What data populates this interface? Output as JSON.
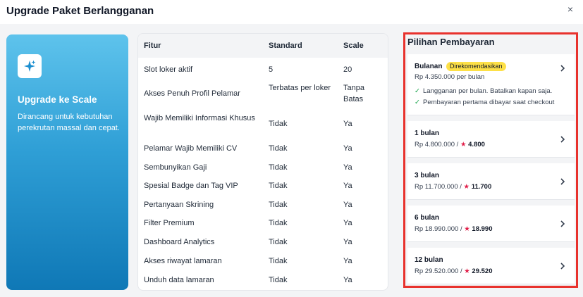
{
  "modal": {
    "title": "Upgrade Paket Berlangganan",
    "close_icon": "×"
  },
  "promo": {
    "icon": "sparkles-icon",
    "title": "Upgrade ke Scale",
    "description": "Dirancang untuk kebutuhan perekrutan massal dan cepat."
  },
  "features": {
    "headers": [
      "Fitur",
      "Standard",
      "Scale"
    ],
    "rows": [
      {
        "feature": "Slot loker aktif",
        "standard": "5",
        "scale": "20"
      },
      {
        "feature": "Akses Penuh Profil Pelamar",
        "standard": "Terbatas per loker",
        "scale": "Tanpa Batas"
      },
      {
        "feature": "Wajib Memiliki Informasi Khusus",
        "standard": "Tidak",
        "scale": "Ya"
      },
      {
        "feature": "Pelamar Wajib Memiliki CV",
        "standard": "Tidak",
        "scale": "Ya"
      },
      {
        "feature": "Sembunyikan Gaji",
        "standard": "Tidak",
        "scale": "Ya"
      },
      {
        "feature": "Spesial Badge dan Tag VIP",
        "standard": "Tidak",
        "scale": "Ya"
      },
      {
        "feature": "Pertanyaan Skrining",
        "standard": "Tidak",
        "scale": "Ya"
      },
      {
        "feature": "Filter Premium",
        "standard": "Tidak",
        "scale": "Ya"
      },
      {
        "feature": "Dashboard Analytics",
        "standard": "Tidak",
        "scale": "Ya"
      },
      {
        "feature": "Akses riwayat lamaran",
        "standard": "Tidak",
        "scale": "Ya"
      },
      {
        "feature": "Unduh data lamaran",
        "standard": "Tidak",
        "scale": "Ya"
      }
    ]
  },
  "payment": {
    "title": "Pilihan Pembayaran",
    "highlight_color": "#e8322d",
    "monthly": {
      "name": "Bulanan",
      "badge": "Direkomendasikan",
      "price": "Rp 4.350.000 per bulan",
      "benefits": [
        "Langganan per bulan. Batalkan kapan saja.",
        "Pembayaran pertama dibayar saat checkout"
      ]
    },
    "options": [
      {
        "name": "1 bulan",
        "price": "Rp 4.800.000 /",
        "star": "★",
        "points": "4.800"
      },
      {
        "name": "3 bulan",
        "price": "Rp 11.700.000 /",
        "star": "★",
        "points": "11.700"
      },
      {
        "name": "6 bulan",
        "price": "Rp 18.990.000 /",
        "star": "★",
        "points": "18.990"
      },
      {
        "name": "12 bulan",
        "price": "Rp 29.520.000 /",
        "star": "★",
        "points": "29.520"
      }
    ]
  }
}
